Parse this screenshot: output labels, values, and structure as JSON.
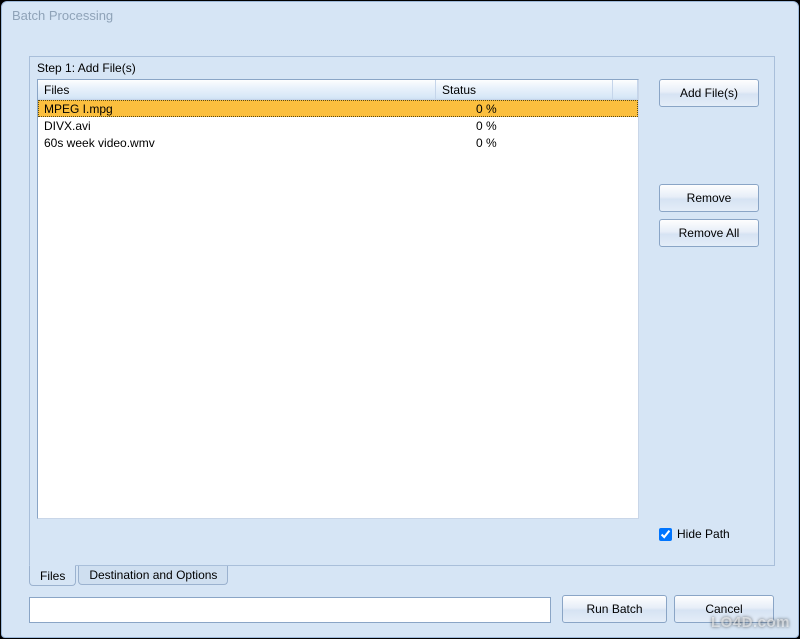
{
  "window": {
    "title": "Batch Processing"
  },
  "step": {
    "label": "Step 1: Add File(s)"
  },
  "list": {
    "columns": {
      "files": "Files",
      "status": "Status"
    },
    "rows": [
      {
        "file": "MPEG I.mpg",
        "status": "0 %",
        "selected": true
      },
      {
        "file": "DIVX.avi",
        "status": "0 %",
        "selected": false
      },
      {
        "file": "60s week video.wmv",
        "status": "0 %",
        "selected": false
      }
    ]
  },
  "buttons": {
    "add_files": "Add File(s)",
    "remove": "Remove",
    "remove_all": "Remove All",
    "run_batch": "Run Batch",
    "cancel": "Cancel"
  },
  "hide_path": {
    "label": "Hide Path",
    "checked": true
  },
  "tabs": {
    "files": "Files",
    "dest": "Destination and Options",
    "active": "files"
  },
  "progress_text": "",
  "watermark": "LO4D.com"
}
